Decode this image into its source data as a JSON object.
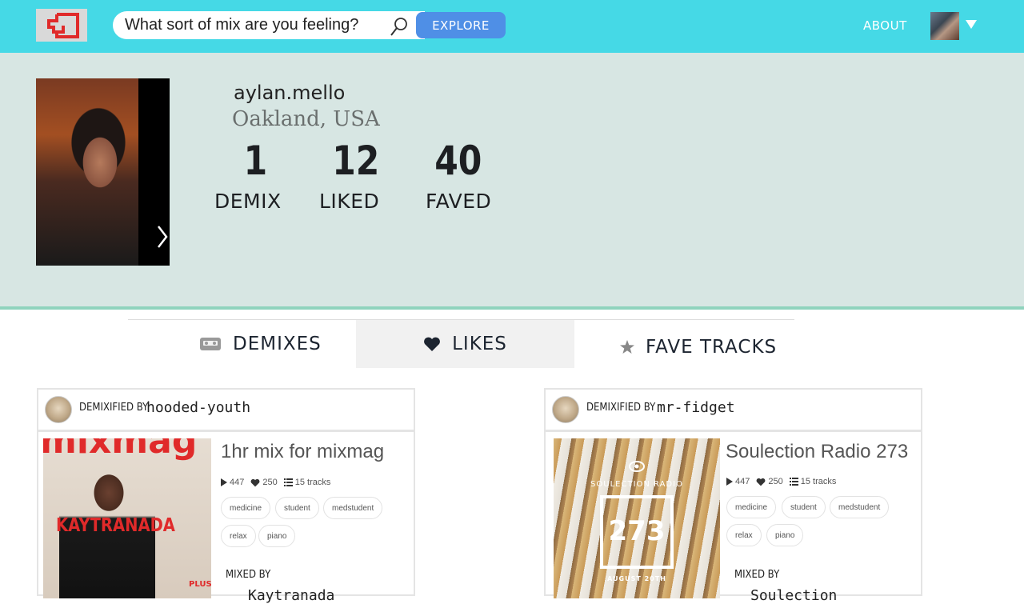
{
  "header": {
    "search_placeholder": "What sort of mix are you feeling?",
    "explore_label": "EXPLORE",
    "about_label": "ABOUT"
  },
  "profile": {
    "username": "aylan.mello",
    "location": "Oakland, USA",
    "stats": [
      {
        "value": "1",
        "label": "DEMIX"
      },
      {
        "value": "12",
        "label": "LIKED"
      },
      {
        "value": "40",
        "label": "FAVED"
      }
    ]
  },
  "tabs": [
    {
      "label": "DEMIXES",
      "icon": "cassette-icon"
    },
    {
      "label": "LIKES",
      "icon": "heart-icon",
      "active": true
    },
    {
      "label": "FAVE TRACKS",
      "icon": "star-icon"
    }
  ],
  "cards": [
    {
      "demixified_label": "DEMIXIFIED BY",
      "demixer": "hooded-youth",
      "title": "1hr mix for mixmag",
      "plays": "447",
      "likes": "250",
      "tracks": "15 tracks",
      "tags": [
        "medicine",
        "student",
        "medstudent",
        "relax",
        "piano"
      ],
      "mixed_by_label": "MIXED BY",
      "mixer": "Kaytranada",
      "cover": {
        "masthead": "mixmag",
        "headline": "KAYTRANADA",
        "plus": "PLUS"
      }
    },
    {
      "demixified_label": "DEMIXIFIED BY",
      "demixer": "mr-fidget",
      "title": "Soulection Radio 273",
      "plays": "447",
      "likes": "250",
      "tracks": "15 tracks",
      "tags": [
        "medicine",
        "student",
        "medstudent",
        "relax",
        "piano"
      ],
      "mixed_by_label": "MIXED BY",
      "mixer": "Soulection",
      "cover": {
        "brand": "SOULECTION RADIO",
        "number": "273",
        "date": "AUGUST 20TH"
      }
    }
  ],
  "colors": {
    "header_bg": "#45d9e6",
    "explore_bg": "#4f8fe6",
    "profile_bg": "#d7e6e3",
    "profile_border": "#8fd3bd"
  }
}
